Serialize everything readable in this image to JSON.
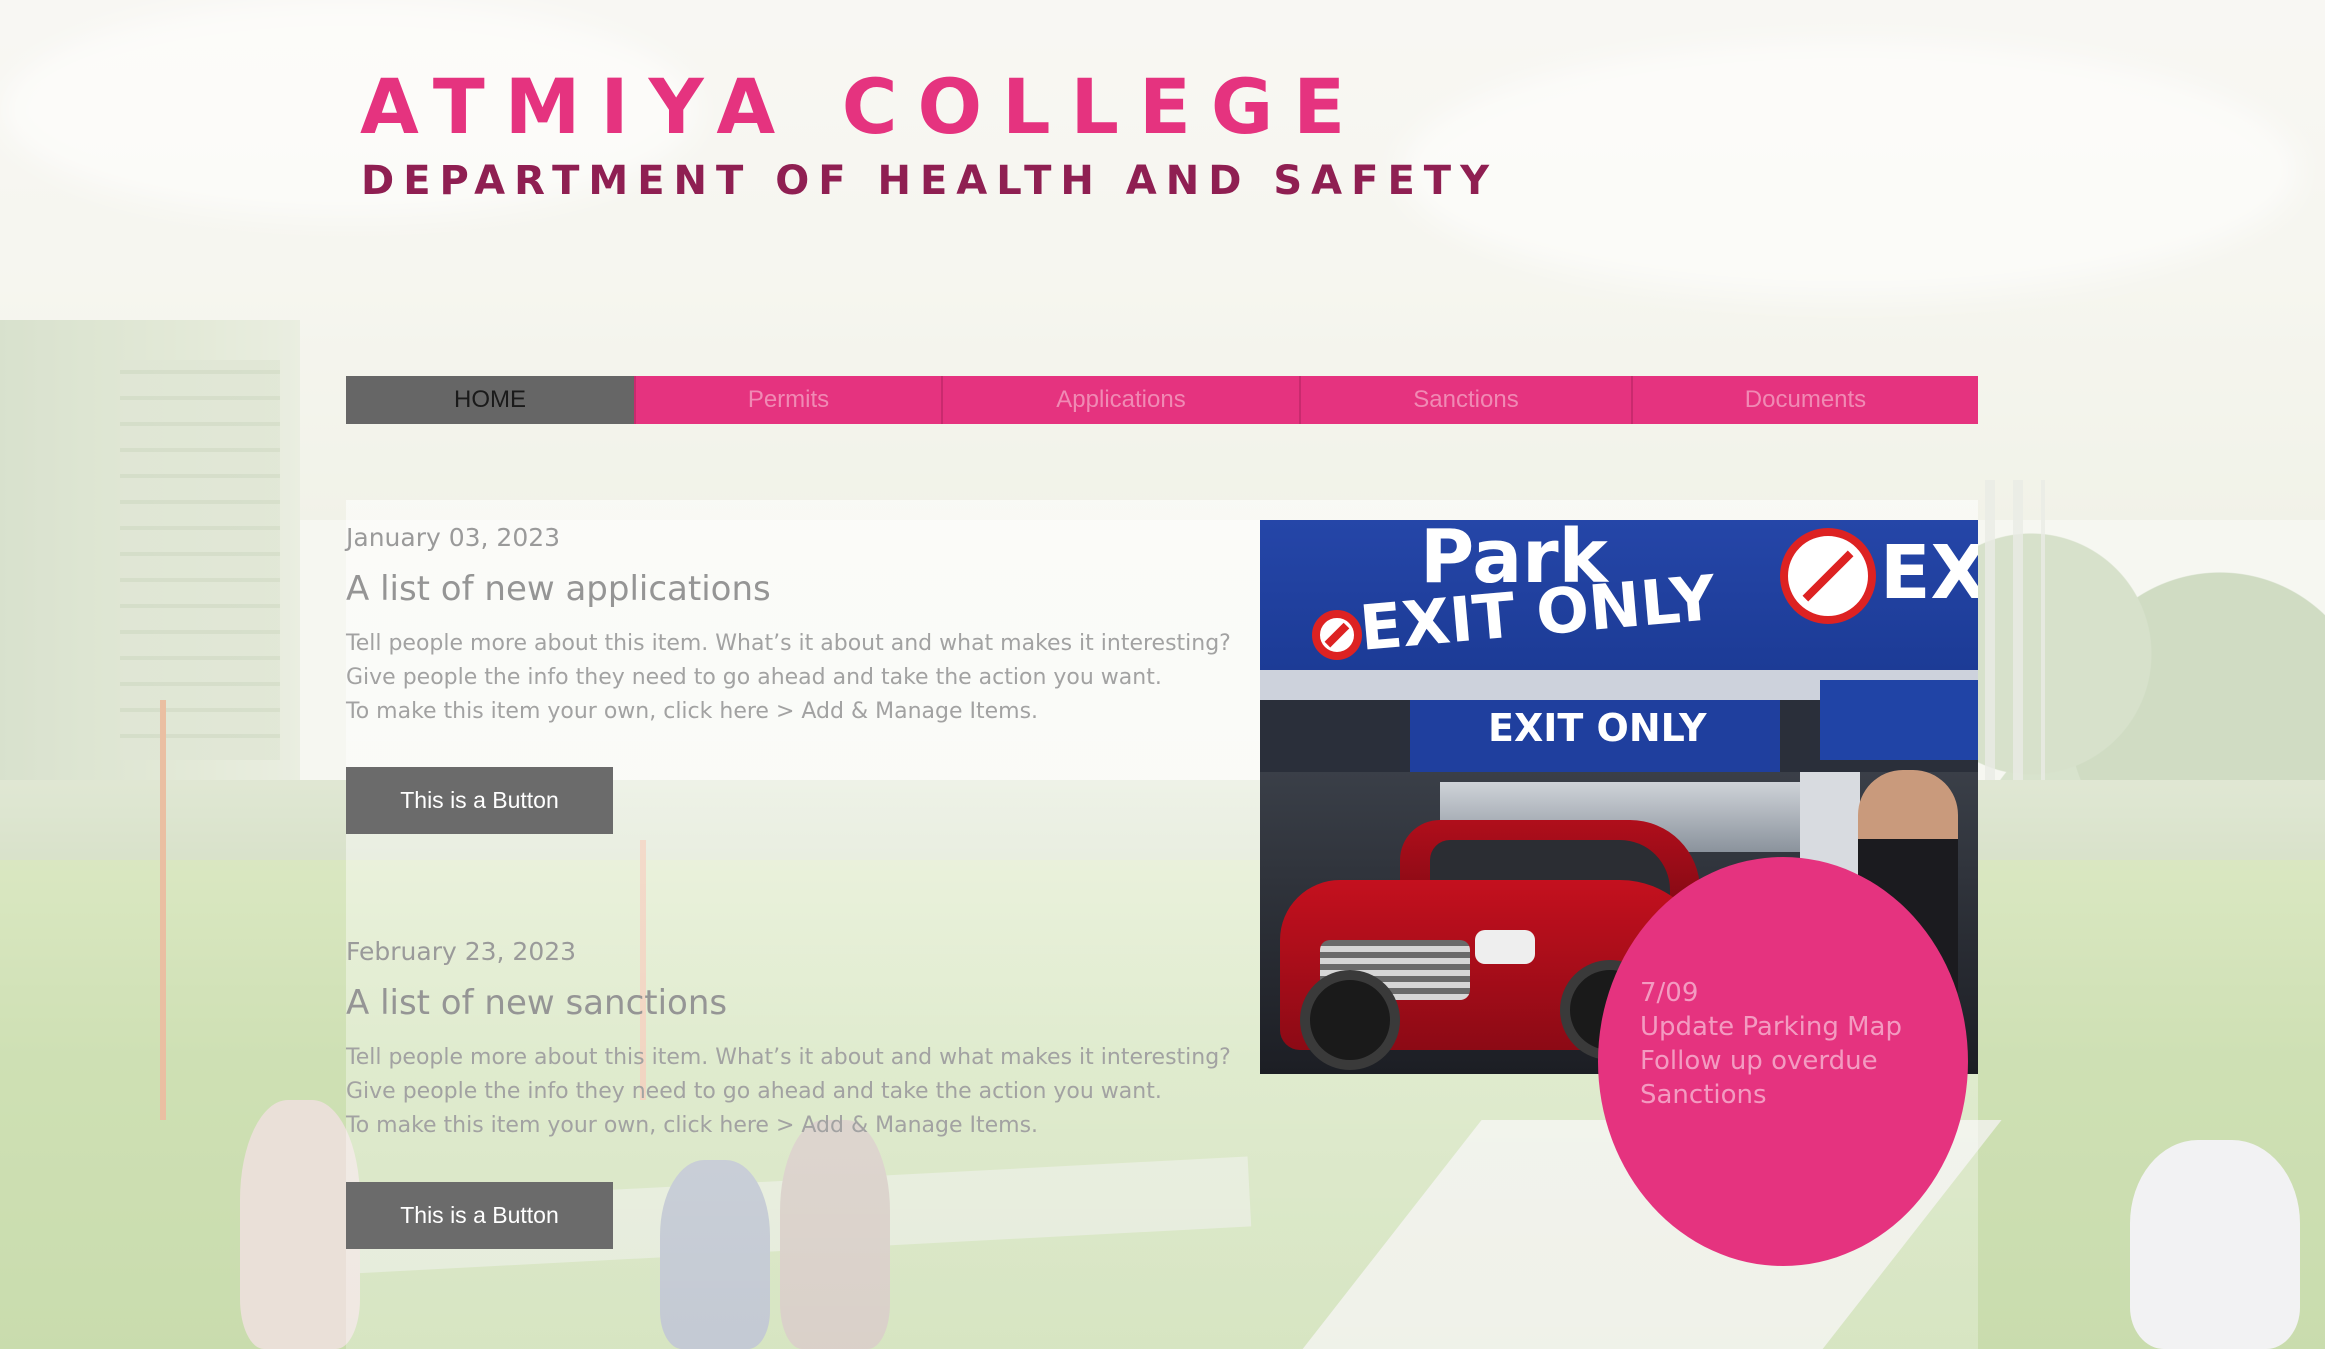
{
  "header": {
    "college": "ATMIYA COLLEGE",
    "department": "DEPARTMENT OF HEALTH AND SAFETY"
  },
  "nav": {
    "items": [
      {
        "label": "HOME",
        "active": true
      },
      {
        "label": "Permits",
        "active": false
      },
      {
        "label": "Applications",
        "active": false
      },
      {
        "label": "Sanctions",
        "active": false
      },
      {
        "label": "Documents",
        "active": false
      }
    ]
  },
  "posts": [
    {
      "date": "January 03, 2023",
      "title": "A list of new applications",
      "body": [
        "Tell people more about this item. What’s it about and what makes it interesting?",
        "Give people the info they need to go ahead and take the action you want.",
        "To make this item your own, click here > Add & Manage Items."
      ],
      "button": "This is a Button"
    },
    {
      "date": "February 23, 2023",
      "title": "A list of new sanctions",
      "body": [
        "Tell people more about this item. What’s it about and what makes it interesting?",
        "Give people the info they need to go ahead and take the action you want.",
        "To make this item your own, click here > Add & Manage Items."
      ],
      "button": "This is a Button"
    }
  ],
  "photo": {
    "sign_park": "Park",
    "sign_exit_only": "EXIT ONLY",
    "sign_parking_exit_only": "EXIT ONLY",
    "sign_right": "EX"
  },
  "notice": {
    "lines": [
      "7/09",
      "Update Parking Map",
      "Follow up overdue",
      "Sanctions"
    ]
  },
  "colors": {
    "brand_pink": "#e5337f",
    "dark_magenta": "#8f1f52",
    "button_gray": "#6b6b6b",
    "nav_active": "#666666"
  }
}
